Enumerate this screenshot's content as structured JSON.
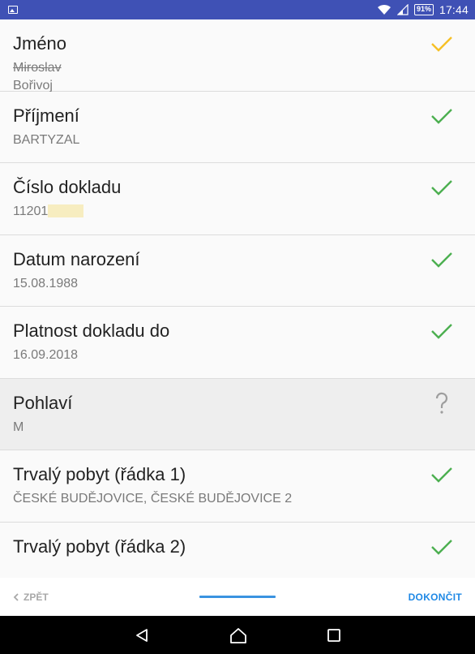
{
  "status_bar": {
    "battery": "91%",
    "time": "17:44",
    "icons": [
      "gallery-icon",
      "wifi-icon",
      "signal-icon",
      "battery-icon"
    ]
  },
  "fields": [
    {
      "label": "Jméno",
      "values": [
        "Miroslav",
        "Bořivoj"
      ],
      "struck": [
        true,
        false
      ],
      "status_icon": "check-icon",
      "status_color": "#f6c026"
    },
    {
      "label": "Příjmení",
      "values": [
        "BARTYZAL"
      ],
      "struck": [
        false
      ],
      "status_icon": "check-icon",
      "status_color": "#4caf50"
    },
    {
      "label": "Číslo dokladu",
      "values": [
        "11201"
      ],
      "struck": [
        false
      ],
      "status_icon": "check-icon",
      "status_color": "#4caf50"
    },
    {
      "label": "Datum narození",
      "values": [
        "15.08.1988"
      ],
      "struck": [
        false
      ],
      "status_icon": "check-icon",
      "status_color": "#4caf50"
    },
    {
      "label": "Platnost dokladu do",
      "values": [
        "16.09.2018"
      ],
      "struck": [
        false
      ],
      "status_icon": "check-icon",
      "status_color": "#4caf50"
    },
    {
      "label": "Pohlaví",
      "values": [
        "M"
      ],
      "struck": [
        false
      ],
      "status_icon": "question-icon",
      "status_color": "#9e9e9e"
    },
    {
      "label": "Trvalý pobyt (řádka 1)",
      "values": [
        "ČESKÉ BUDĚJOVICE, ČESKÉ BUDĚJOVICE 2"
      ],
      "struck": [
        false
      ],
      "status_icon": "check-icon",
      "status_color": "#4caf50"
    },
    {
      "label": "Trvalý pobyt (řádka 2)",
      "values": [],
      "struck": [],
      "status_icon": "check-icon",
      "status_color": "#4caf50"
    }
  ],
  "bottom_bar": {
    "back_label": "ZPĚT",
    "finish_label": "DOKONČIT"
  },
  "colors": {
    "status_bar": "#3f51b5",
    "accent": "#1e88e5",
    "check_ok": "#4caf50",
    "check_warn": "#f6c026"
  }
}
